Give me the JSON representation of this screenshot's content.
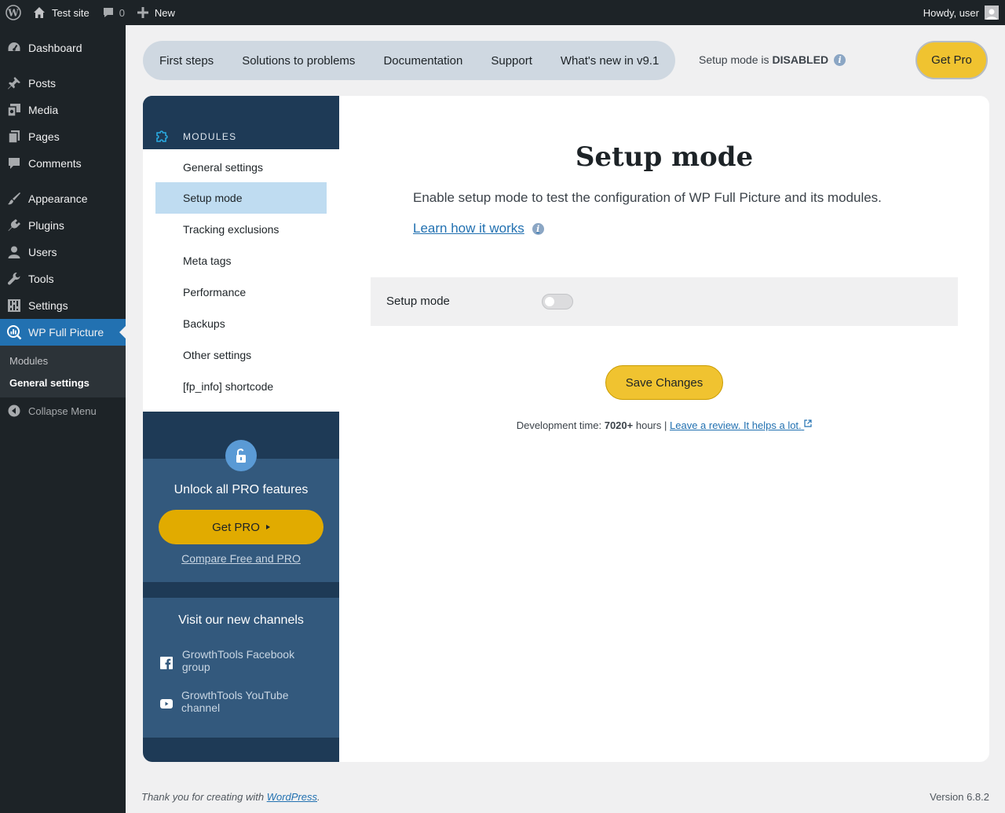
{
  "adminbar": {
    "site_name": "Test site",
    "comments_count": "0",
    "new_label": "New",
    "howdy": "Howdy, user"
  },
  "menu": {
    "items": [
      {
        "label": "Dashboard",
        "icon": "dashboard-icon"
      },
      {
        "label": "Posts",
        "icon": "pin-icon"
      },
      {
        "label": "Media",
        "icon": "media-icon"
      },
      {
        "label": "Pages",
        "icon": "pages-icon"
      },
      {
        "label": "Comments",
        "icon": "comment-icon"
      },
      {
        "label": "Appearance",
        "icon": "brush-icon"
      },
      {
        "label": "Plugins",
        "icon": "plug-icon"
      },
      {
        "label": "Users",
        "icon": "user-icon"
      },
      {
        "label": "Tools",
        "icon": "wrench-icon"
      },
      {
        "label": "Settings",
        "icon": "sliders-icon"
      },
      {
        "label": "WP Full Picture",
        "icon": "chart-magnifier-icon"
      }
    ],
    "submenu": [
      "Modules",
      "General settings"
    ],
    "collapse": "Collapse Menu"
  },
  "tabs": [
    "First steps",
    "Solutions to problems",
    "Documentation",
    "Support",
    "What's new in v9.1"
  ],
  "setup_status": {
    "prefix": "Setup mode is",
    "value": "DISABLED"
  },
  "get_pro_top": "Get Pro",
  "modules": {
    "heading": "MODULES",
    "items": [
      "General settings",
      "Setup mode",
      "Tracking exclusions",
      "Meta tags",
      "Performance",
      "Backups",
      "Other settings",
      "[fp_info] shortcode"
    ],
    "active": "Setup mode"
  },
  "upgrade": {
    "title": "Unlock all PRO features",
    "button": "Get PRO",
    "compare": "Compare Free and PRO"
  },
  "channels": {
    "title": "Visit our new channels",
    "links": [
      "GrowthTools Facebook group",
      "GrowthTools YouTube channel"
    ]
  },
  "main": {
    "title": "Setup mode",
    "lead": "Enable setup mode to test the configuration of WP Full Picture and its modules.",
    "learn": "Learn how it works",
    "field_label": "Setup mode",
    "toggle_on": false,
    "save": "Save Changes",
    "dev_prefix": "Development time:",
    "dev_hours": "7020+",
    "dev_suffix": "hours |",
    "review": "Leave a review. It helps a lot."
  },
  "footer": {
    "thanks_prefix": "Thank you for creating with",
    "thanks_link": "WordPress",
    "thanks_suffix": ".",
    "version": "Version 6.8.2"
  },
  "colors": {
    "admin_dark": "#1d2327",
    "accent_blue": "#2271b1",
    "yellow": "#f0c330",
    "panel_navy": "#1e3a56",
    "panel_blue": "#33597d"
  }
}
